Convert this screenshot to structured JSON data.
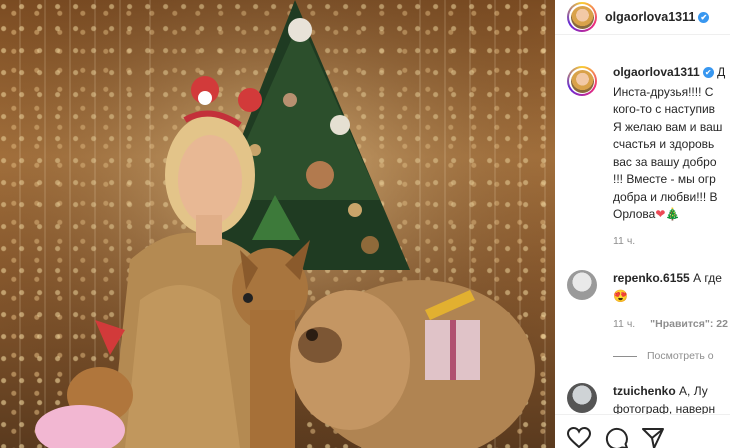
{
  "post": {
    "username": "olgaorlova1311",
    "verified_mark": "✔"
  },
  "caption": {
    "username": "olgaorlova1311",
    "lines": [
      "Д",
      "Инста-друзья!!!! С",
      "кого-то с наступив",
      "Я желаю вам и ваш",
      "счастья и здоровь",
      "вас за вашу добро",
      "!!! Вместе - мы огр",
      "добра и любви!!! В",
      "Орлова"
    ],
    "emoji": [
      "❤",
      "🎄"
    ],
    "time": "11 ч."
  },
  "comments": [
    {
      "username": "repenko.6155",
      "text": "А где",
      "line2": "😍",
      "time": "11 ч.",
      "likes": "\"Нравится\": 22",
      "replies": "Посмотреть о"
    },
    {
      "username": "tzuichenko",
      "text": "А, Лу",
      "line2": "фотограф, наверн"
    }
  ],
  "actions": {
    "like_icon": "heart-icon",
    "comment_icon": "comment-icon",
    "share_icon": "share-icon"
  },
  "colors": {
    "verified": "#3897f0",
    "heart": "#ed4956"
  }
}
